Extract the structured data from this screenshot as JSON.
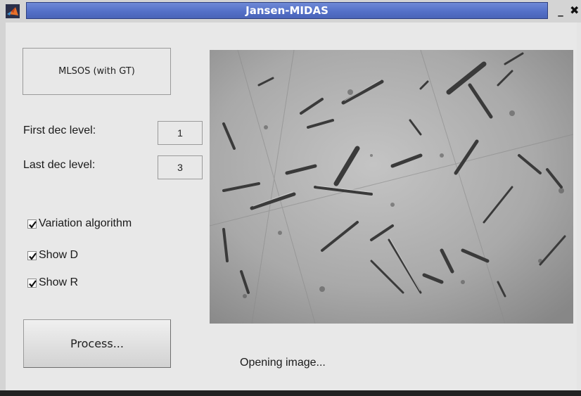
{
  "window": {
    "title": "Jansen-MIDAS",
    "minimize_glyph": "_",
    "close_glyph": "✖",
    "app_icon": "matlab-logo-icon"
  },
  "controls": {
    "method_button": "MLSOS (with GT)",
    "first_dec_label": "First dec level:",
    "first_dec_value": "1",
    "last_dec_label": "Last dec level:",
    "last_dec_value": "3",
    "checkboxes": [
      {
        "label": "Variation algorithm",
        "checked": true
      },
      {
        "label": "Show D",
        "checked": true
      },
      {
        "label": "Show R",
        "checked": true
      }
    ],
    "process_button": "Process..."
  },
  "image_panel": {
    "content": "microscopy-crystals-image"
  },
  "status": {
    "text": "Opening image..."
  },
  "colors": {
    "title_bar": "#5470c8",
    "window_bg": "#e8e8e8"
  }
}
